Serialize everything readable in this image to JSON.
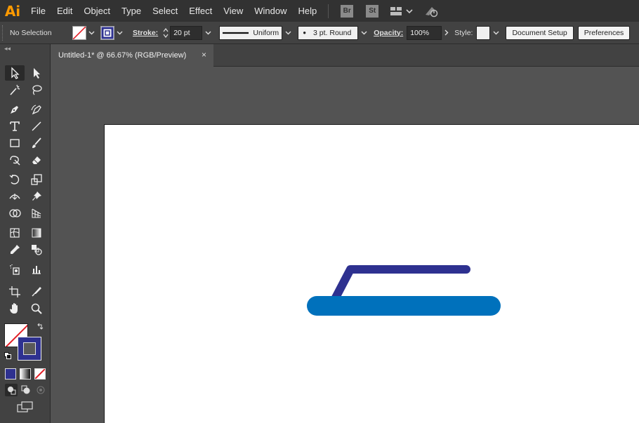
{
  "app": {
    "logo": "Ai",
    "menu": [
      "File",
      "Edit",
      "Object",
      "Type",
      "Select",
      "Effect",
      "View",
      "Window",
      "Help"
    ],
    "bridge_label": "Br",
    "stock_label": "St",
    "arrange_icon": "arrange-documents-icon",
    "gpu_icon": "gpu-performance-icon"
  },
  "controlbar": {
    "selection": "No Selection",
    "stroke_label": "Stroke:",
    "stroke_weight": "20 pt",
    "profile": "Uniform",
    "brush": "3 pt. Round",
    "opacity_label": "Opacity:",
    "opacity_value": "100%",
    "style_label": "Style:",
    "document_setup": "Document Setup",
    "preferences": "Preferences",
    "stroke_color": "#2e3190"
  },
  "toolbox": {
    "collapse": "◂◂"
  },
  "document": {
    "tab_title": "Untitled-1* @ 66.67% (RGB/Preview)",
    "close": "×"
  },
  "artwork": {
    "handle_color": "#2e3190",
    "base_color": "#0071bc"
  }
}
